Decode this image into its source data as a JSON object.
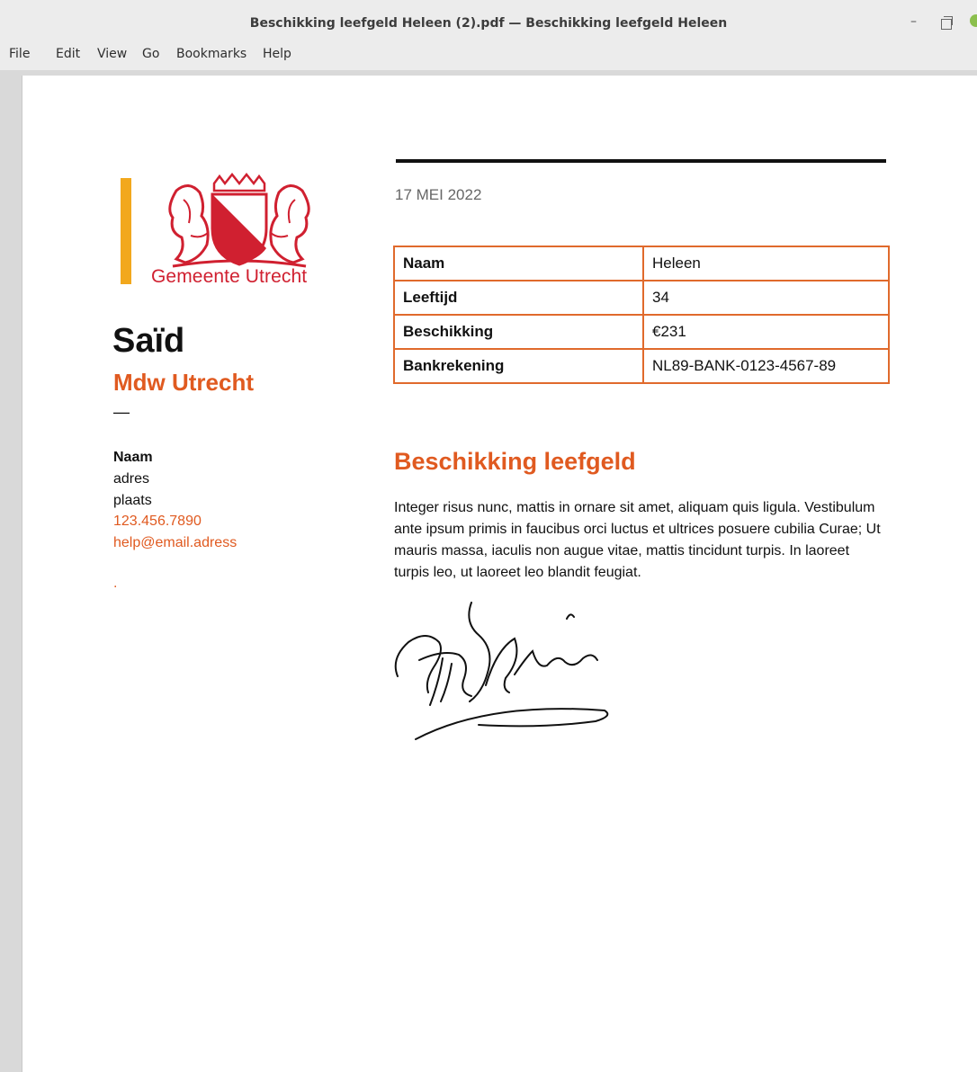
{
  "window": {
    "title": "Beschikking leefgeld Heleen (2).pdf — Beschikking leefgeld Heleen",
    "minimize": "–"
  },
  "menu": [
    "File",
    "Edit",
    "View",
    "Go",
    "Bookmarks",
    "Help"
  ],
  "colors": {
    "accent": "#e05a20",
    "logo_red": "#d02030",
    "bar_yellow": "#f2a81d",
    "table_border": "#e06a2c"
  },
  "sidebar": {
    "logo_text": "Gemeente Utrecht",
    "name": "Saïd",
    "role": "Mdw Utrecht",
    "dash": "—",
    "contact": {
      "naam": "Naam",
      "adres": "adres",
      "plaats": "plaats",
      "phone": "123.456.7890",
      "email": "help@email.adress",
      "dot": "."
    }
  },
  "document": {
    "date": "17 MEI 2022",
    "table": [
      {
        "key": "Naam",
        "value": "Heleen"
      },
      {
        "key": "Leeftijd",
        "value": "34"
      },
      {
        "key": "Beschikking",
        "value": "€231"
      },
      {
        "key": "Bankrekening",
        "value": "NL89-BANK-0123-4567-89"
      }
    ],
    "section_title": "Beschikking leefgeld",
    "body": "Integer risus nunc, mattis in ornare sit amet, aliquam quis ligula. Vestibulum ante ipsum primis in faucibus orci luctus et ultrices posuere cubilia Curae; Ut mauris massa, iaculis non augue vitae, mattis tincidunt turpis. In laoreet turpis leo, ut laoreet leo blandit feugiat."
  }
}
